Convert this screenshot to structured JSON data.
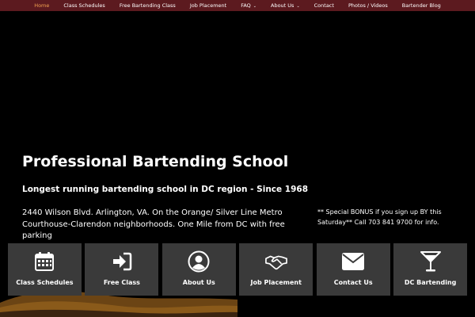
{
  "nav": {
    "items": [
      {
        "label": "Home",
        "active": true,
        "dropdown": false
      },
      {
        "label": "Class Schedules",
        "active": false,
        "dropdown": false
      },
      {
        "label": "Free Bartending Class",
        "active": false,
        "dropdown": false
      },
      {
        "label": "Job Placement",
        "active": false,
        "dropdown": false
      },
      {
        "label": "FAQ",
        "active": false,
        "dropdown": true
      },
      {
        "label": "About Us",
        "active": false,
        "dropdown": true
      },
      {
        "label": "Contact",
        "active": false,
        "dropdown": false
      },
      {
        "label": "Photos / Videos",
        "active": false,
        "dropdown": false
      },
      {
        "label": "Bartender Blog",
        "active": false,
        "dropdown": false
      }
    ],
    "dropdown_glyph": "⌄"
  },
  "hero": {
    "title": "Professional Bartending School",
    "subtitle": "Longest running bartending school in DC region - Since 1968",
    "address": "2440 Wilson Blvd. Arlington, VA.  On the Orange/ Silver Line Metro Courthouse-Clarendon neighborhoods. One Mile from DC with free parking",
    "bonus": "** Special BONUS if you sign up BY this Saturday**  Call 703 841 9700 for info."
  },
  "tiles": [
    {
      "label": "Class Schedules",
      "icon": "calendar-icon"
    },
    {
      "label": "Free Class",
      "icon": "sign-in-icon"
    },
    {
      "label": "About Us",
      "icon": "user-circle-icon"
    },
    {
      "label": "Job Placement",
      "icon": "handshake-icon"
    },
    {
      "label": "Contact Us",
      "icon": "envelope-icon"
    },
    {
      "label": "DC Bartending",
      "icon": "martini-glass-icon"
    }
  ],
  "colors": {
    "nav_bg": "#5c1a1f",
    "nav_active": "#f0a050",
    "tile_bg": "#3a3a3a",
    "wave_gold": "#8a5a1a",
    "wave_dark": "#3b2410"
  }
}
